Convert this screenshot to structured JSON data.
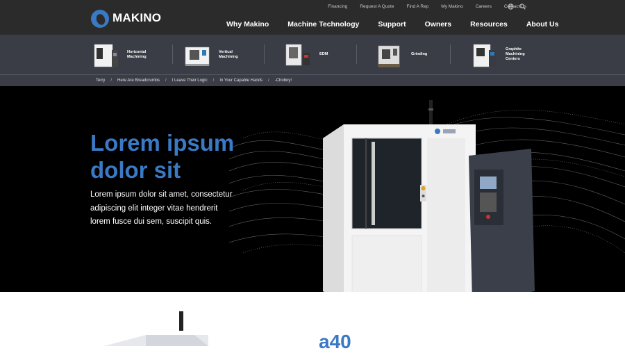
{
  "brand": {
    "name": "MAKINO",
    "color": "#3a79c4"
  },
  "utility_nav": [
    "Financing",
    "Request A Quote",
    "Find A Rep",
    "My Makino",
    "Careers",
    "Contact Us"
  ],
  "main_nav": [
    "Why Makino",
    "Machine Technology",
    "Support",
    "Owners",
    "Resources",
    "About Us"
  ],
  "categories": [
    {
      "label": "Horizontal Machining"
    },
    {
      "label": "Vertical Machining"
    },
    {
      "label": "EDM"
    },
    {
      "label": "Grinding"
    },
    {
      "label": "Graphite Machining Centers"
    }
  ],
  "breadcrumbs": [
    "Terry",
    "Here Are Breadcrumbs",
    "I Leave Their Logic",
    "In Your Capable Hands",
    "-Choboy!"
  ],
  "hero": {
    "title": "Lorem ipsum dolor sit",
    "body": "Lorem ipsum dolor sit amet, consectetur adipiscing elit integer vitae hendrerit lorem fusce dui sem, suscipit quis."
  },
  "product": {
    "model": "a40"
  },
  "icons": [
    "globe-icon",
    "search-icon"
  ]
}
